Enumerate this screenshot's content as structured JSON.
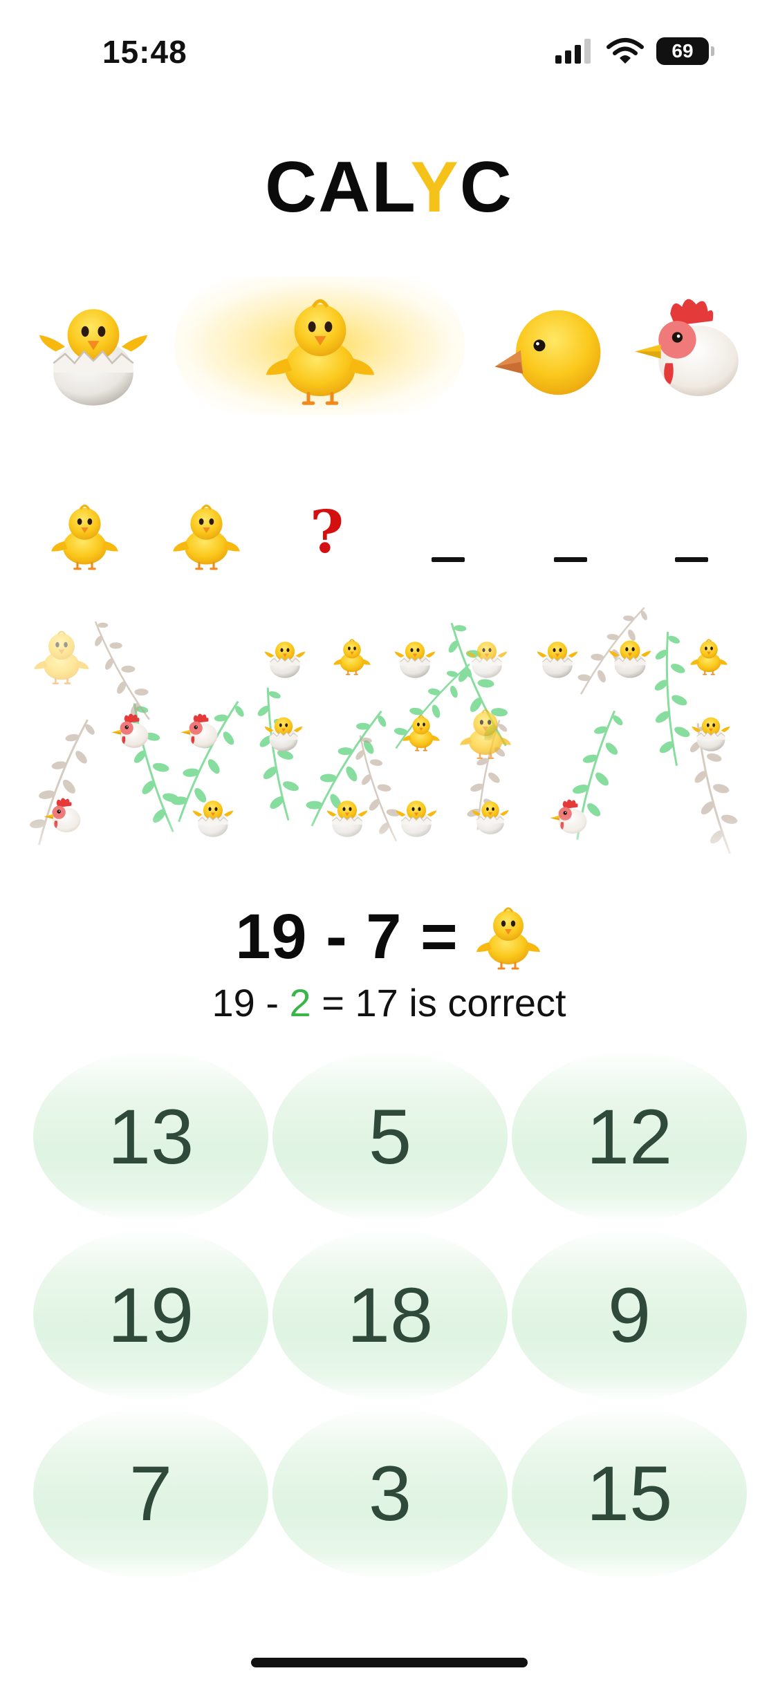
{
  "status_bar": {
    "time": "15:48",
    "battery_level": "69",
    "icons": [
      "cellular-signal-icon",
      "wifi-icon",
      "battery-icon"
    ]
  },
  "app": {
    "title_prefix": "CAL",
    "title_accent": "Y",
    "title_suffix": "C",
    "accent_color": "#f5c21a"
  },
  "stages": [
    {
      "name": "hatching-chick",
      "active": false
    },
    {
      "name": "baby-chick",
      "active": true
    },
    {
      "name": "chick-head",
      "active": false
    },
    {
      "name": "rooster",
      "active": false
    }
  ],
  "progress": {
    "items": [
      "baby-chick",
      "baby-chick",
      "question",
      "blank",
      "blank",
      "blank"
    ],
    "question_mark": "?"
  },
  "question": {
    "left": "19 - 7 =",
    "answer_icon": "baby-chick"
  },
  "feedback": {
    "prefix": "19 - ",
    "highlight": "2",
    "suffix": " = 17 is correct",
    "highlight_color": "#3ab54a"
  },
  "keypad": {
    "keys": [
      "13",
      "5",
      "12",
      "19",
      "18",
      "9",
      "7",
      "3",
      "15"
    ],
    "key_text_color": "#2f4a3a",
    "key_color": "#dff4e2"
  }
}
